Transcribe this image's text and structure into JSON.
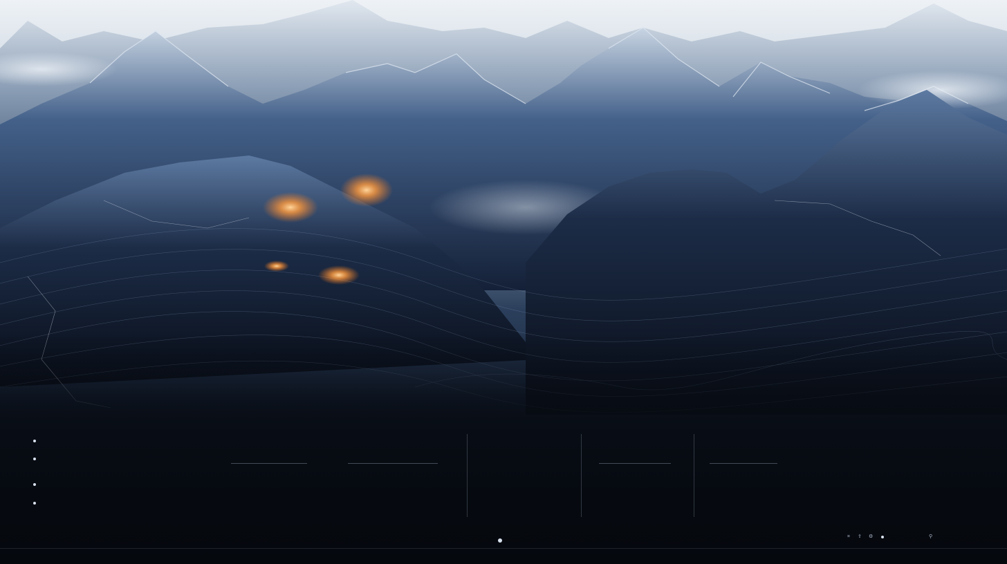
{
  "scene": {
    "description_colors": {
      "sky": "#dfe6ee",
      "mountain_dark": "#17243a",
      "mountain_mid": "#3b567a",
      "snow": "#e8eef5",
      "glow": "#ff9a3c",
      "panel_bg": "#070b12"
    }
  },
  "legend": {
    "items": [
      {
        "text": ""
      },
      {
        "text": ""
      },
      {
        "text": ""
      },
      {
        "text": ""
      },
      {
        "text": ""
      },
      {
        "text": ""
      }
    ]
  },
  "columns": [
    {
      "title": "",
      "lines": [
        "",
        ""
      ],
      "title2": "",
      "lines2": [
        "",
        "",
        "",
        ""
      ]
    },
    {
      "title": "",
      "lines": [
        "",
        ""
      ],
      "title2": "",
      "lines2": [
        "",
        "",
        "",
        ""
      ]
    },
    {
      "title": "",
      "lines": [
        "",
        ""
      ],
      "title2": "",
      "lines2": [
        "",
        "",
        "",
        ""
      ]
    },
    {
      "title": "",
      "lines": [
        "",
        ""
      ],
      "title2": "",
      "lines2": [
        "",
        "",
        "",
        ""
      ]
    },
    {
      "title": "",
      "lines": [
        "",
        ""
      ],
      "title2": "",
      "lines2": [
        "",
        "",
        "",
        ""
      ]
    },
    {
      "title": "",
      "lines": [
        "",
        ""
      ],
      "title2": "",
      "lines2": [
        "",
        "",
        "",
        ""
      ]
    }
  ],
  "footer": {
    "center_label": "",
    "center_sub": "",
    "right_labels": [
      "",
      ""
    ],
    "icons": [
      "grid-icon",
      "share-icon",
      "settings-icon",
      "dot-icon",
      "link-icon"
    ]
  }
}
